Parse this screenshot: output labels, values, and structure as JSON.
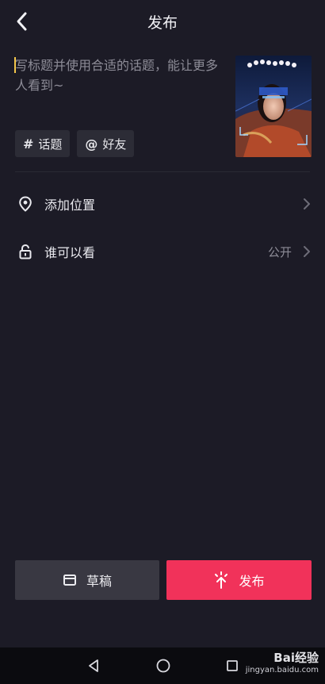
{
  "header": {
    "title": "发布"
  },
  "caption": {
    "placeholder": "写标题并使用合适的话题，能让更多人看到~"
  },
  "chips": [
    {
      "symbol": "#",
      "label": "话题"
    },
    {
      "symbol": "@",
      "label": "好友"
    }
  ],
  "rows": {
    "location": {
      "label": "添加位置"
    },
    "visibility": {
      "label": "谁可以看",
      "value": "公开"
    }
  },
  "actions": {
    "draft_label": "草稿",
    "publish_label": "发布"
  },
  "colors": {
    "accent": "#f1325a",
    "background": "#1c1b26",
    "cursor": "#f3c64a"
  },
  "watermark": {
    "brand": "Bai经验",
    "url": "jingyan.baidu.com"
  }
}
